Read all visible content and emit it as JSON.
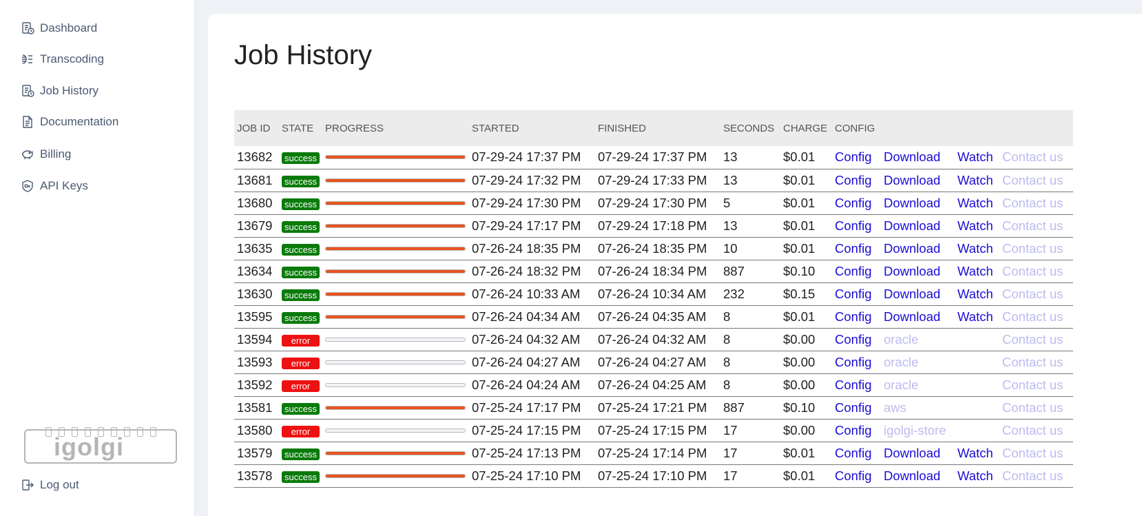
{
  "sidebar": {
    "items": [
      {
        "label": "Dashboard",
        "icon": "dashboard-icon"
      },
      {
        "label": "Transcoding",
        "icon": "transcoding-icon"
      },
      {
        "label": "Job History",
        "icon": "job-history-icon"
      },
      {
        "label": "Documentation",
        "icon": "document-icon"
      },
      {
        "label": "Billing",
        "icon": "piggy-bank-icon"
      },
      {
        "label": "API Keys",
        "icon": "key-shield-icon"
      }
    ],
    "logo_text": "igolgi",
    "logout_label": "Log out"
  },
  "main": {
    "title": "Job History",
    "columns": [
      "JOB ID",
      "STATE",
      "PROGRESS",
      "STARTED",
      "FINISHED",
      "SECONDS",
      "CHARGE",
      "CONFIG"
    ],
    "rows": [
      {
        "id": "13682",
        "state": "success",
        "progress": 1,
        "started": "07-29-24 17:37 PM",
        "finished": "07-29-24 17:37 PM",
        "seconds": "13",
        "charge": "$0.01",
        "config": "Config",
        "download": "Download",
        "watch": "Watch",
        "contact": "Contact us"
      },
      {
        "id": "13681",
        "state": "success",
        "progress": 1,
        "started": "07-29-24 17:32 PM",
        "finished": "07-29-24 17:33 PM",
        "seconds": "13",
        "charge": "$0.01",
        "config": "Config",
        "download": "Download",
        "watch": "Watch",
        "contact": "Contact us"
      },
      {
        "id": "13680",
        "state": "success",
        "progress": 1,
        "started": "07-29-24 17:30 PM",
        "finished": "07-29-24 17:30 PM",
        "seconds": "5",
        "charge": "$0.01",
        "config": "Config",
        "download": "Download",
        "watch": "Watch",
        "contact": "Contact us"
      },
      {
        "id": "13679",
        "state": "success",
        "progress": 1,
        "started": "07-29-24 17:17 PM",
        "finished": "07-29-24 17:18 PM",
        "seconds": "13",
        "charge": "$0.01",
        "config": "Config",
        "download": "Download",
        "watch": "Watch",
        "contact": "Contact us"
      },
      {
        "id": "13635",
        "state": "success",
        "progress": 1,
        "started": "07-26-24 18:35 PM",
        "finished": "07-26-24 18:35 PM",
        "seconds": "10",
        "charge": "$0.01",
        "config": "Config",
        "download": "Download",
        "watch": "Watch",
        "contact": "Contact us"
      },
      {
        "id": "13634",
        "state": "success",
        "progress": 1,
        "started": "07-26-24 18:32 PM",
        "finished": "07-26-24 18:34 PM",
        "seconds": "887",
        "charge": "$0.10",
        "config": "Config",
        "download": "Download",
        "watch": "Watch",
        "contact": "Contact us"
      },
      {
        "id": "13630",
        "state": "success",
        "progress": 1,
        "started": "07-26-24 10:33 AM",
        "finished": "07-26-24 10:34 AM",
        "seconds": "232",
        "charge": "$0.15",
        "config": "Config",
        "download": "Download",
        "watch": "Watch",
        "contact": "Contact us"
      },
      {
        "id": "13595",
        "state": "success",
        "progress": 1,
        "started": "07-26-24 04:34 AM",
        "finished": "07-26-24 04:35 AM",
        "seconds": "8",
        "charge": "$0.01",
        "config": "Config",
        "download": "Download",
        "watch": "Watch",
        "contact": "Contact us"
      },
      {
        "id": "13594",
        "state": "error",
        "progress": 0,
        "started": "07-26-24 04:32 AM",
        "finished": "07-26-24 04:32 AM",
        "seconds": "8",
        "charge": "$0.00",
        "config": "Config",
        "download": "oracle",
        "watch": "",
        "contact": "Contact us"
      },
      {
        "id": "13593",
        "state": "error",
        "progress": 0,
        "started": "07-26-24 04:27 AM",
        "finished": "07-26-24 04:27 AM",
        "seconds": "8",
        "charge": "$0.00",
        "config": "Config",
        "download": "oracle",
        "watch": "",
        "contact": "Contact us"
      },
      {
        "id": "13592",
        "state": "error",
        "progress": 0,
        "started": "07-26-24 04:24 AM",
        "finished": "07-26-24 04:25 AM",
        "seconds": "8",
        "charge": "$0.00",
        "config": "Config",
        "download": "oracle",
        "watch": "",
        "contact": "Contact us"
      },
      {
        "id": "13581",
        "state": "success",
        "progress": 1,
        "started": "07-25-24 17:17 PM",
        "finished": "07-25-24 17:21 PM",
        "seconds": "887",
        "charge": "$0.10",
        "config": "Config",
        "download": "aws",
        "watch": "",
        "contact": "Contact us"
      },
      {
        "id": "13580",
        "state": "error",
        "progress": 0,
        "started": "07-25-24 17:15 PM",
        "finished": "07-25-24 17:15 PM",
        "seconds": "17",
        "charge": "$0.00",
        "config": "Config",
        "download": "igolgi-store",
        "watch": "",
        "contact": "Contact us"
      },
      {
        "id": "13579",
        "state": "success",
        "progress": 1,
        "started": "07-25-24 17:13 PM",
        "finished": "07-25-24 17:14 PM",
        "seconds": "17",
        "charge": "$0.01",
        "config": "Config",
        "download": "Download",
        "watch": "Watch",
        "contact": "Contact us"
      },
      {
        "id": "13578",
        "state": "success",
        "progress": 1,
        "started": "07-25-24 17:10 PM",
        "finished": "07-25-24 17:10 PM",
        "seconds": "17",
        "charge": "$0.01",
        "config": "Config",
        "download": "Download",
        "watch": "Watch",
        "contact": "Contact us"
      }
    ]
  },
  "colors": {
    "success": "#0a7a0a",
    "error": "#ee1111",
    "progress": "#e8541f",
    "link": "#1a0dd6",
    "muted_link": "#bdbbf0",
    "nav_text": "#4a5a72"
  }
}
